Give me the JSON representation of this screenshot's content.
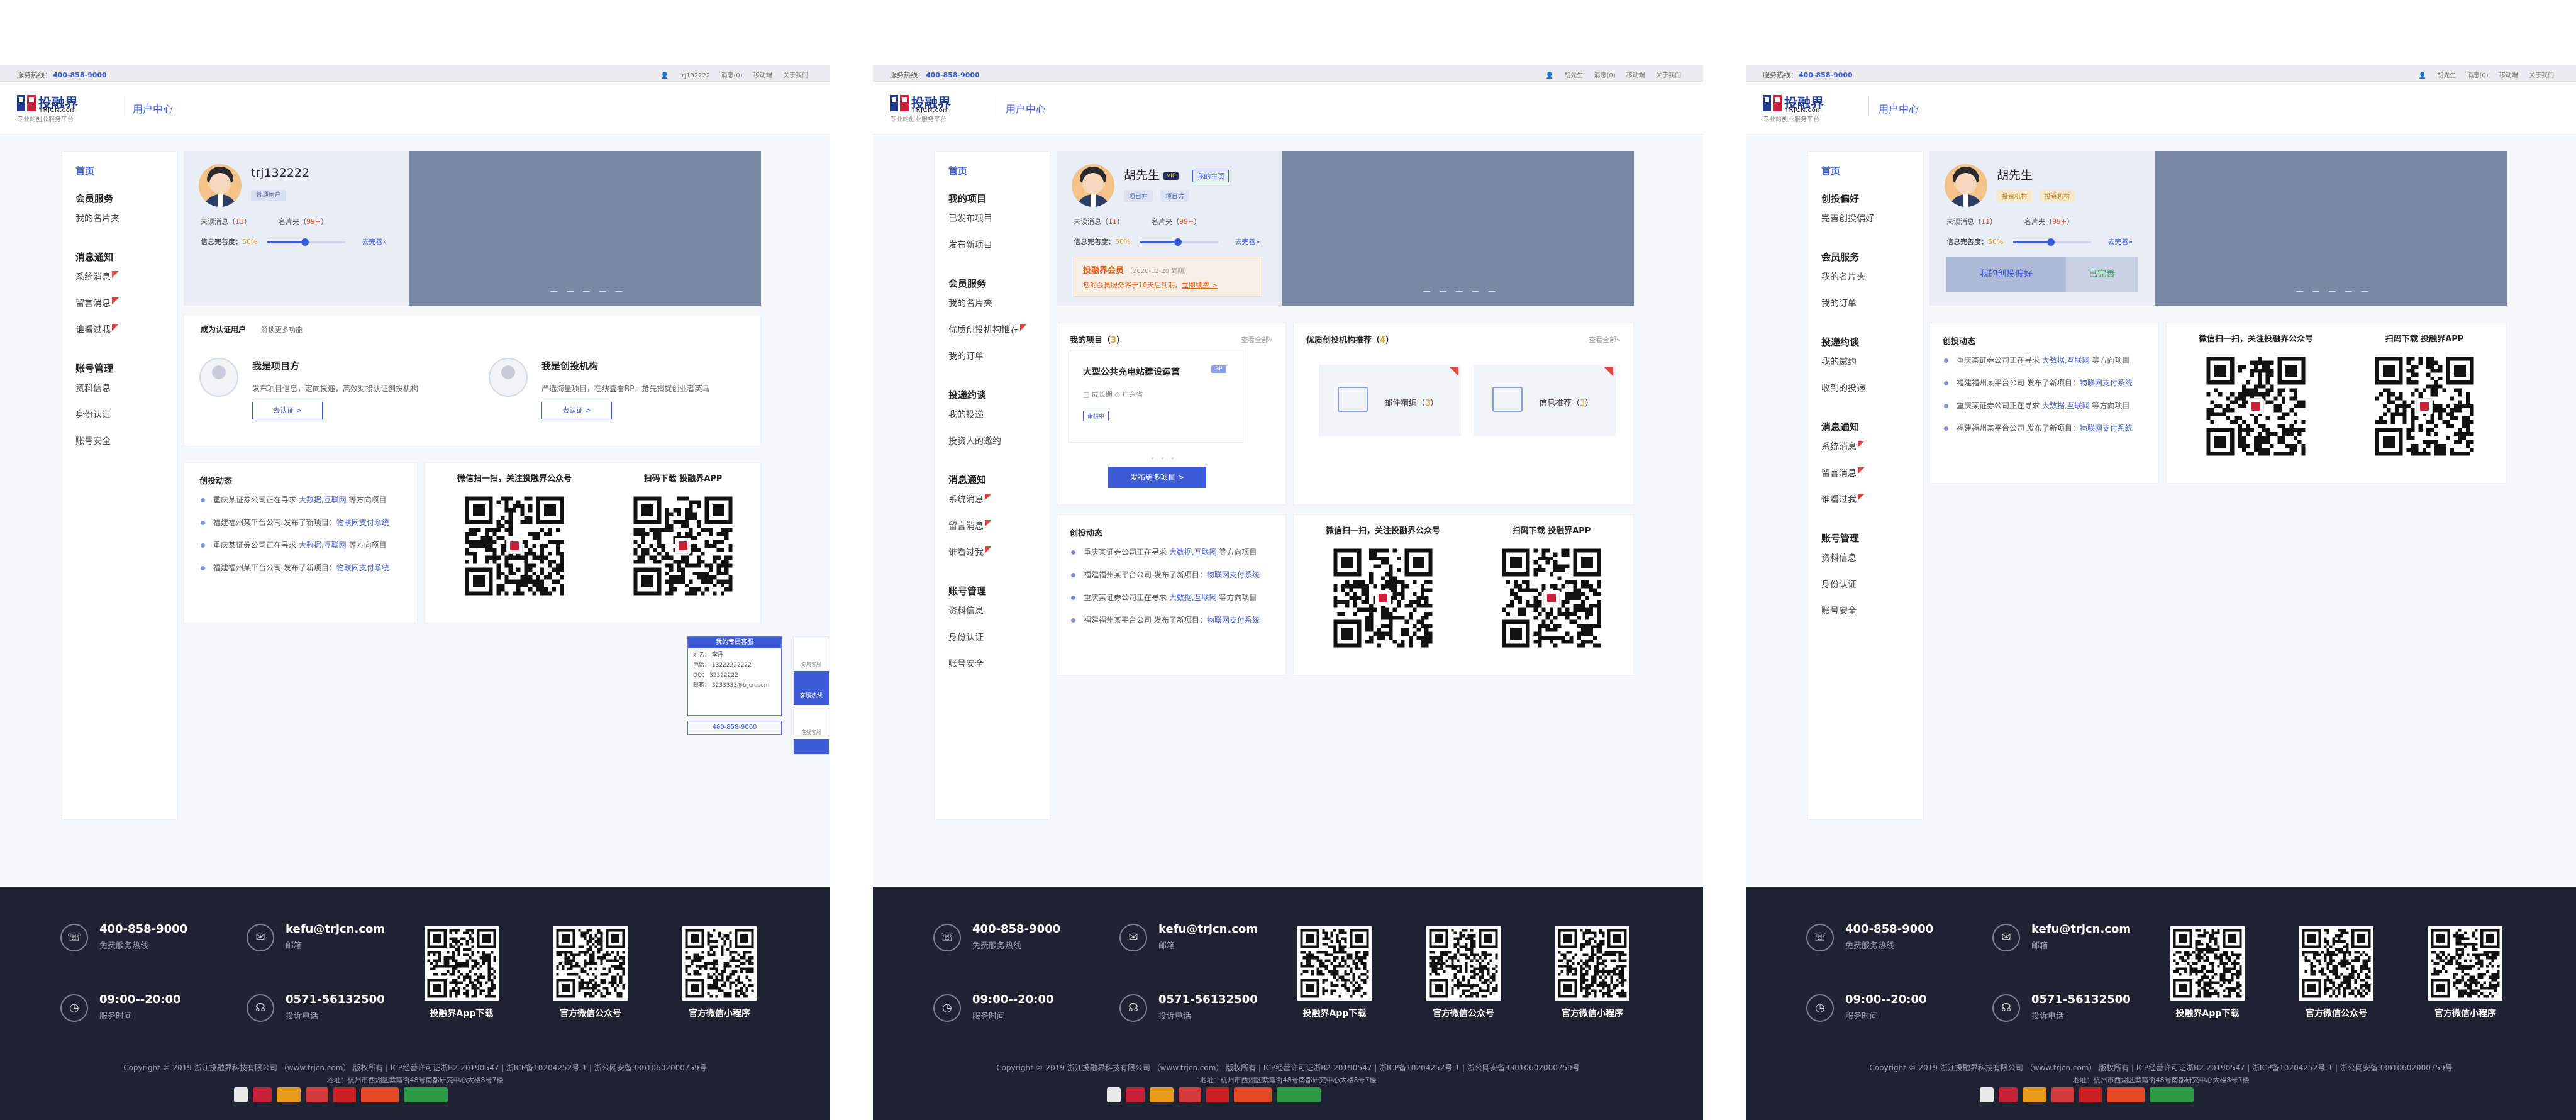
{
  "common": {
    "hotline_label": "服务热线：",
    "hotline": "400-858-9000",
    "top_links": [
      "消息(0)",
      "移动端",
      "关于我们"
    ],
    "logo_cn": "投融界",
    "logo_en": "TRJCN.com",
    "slogan": "专业的创业服务平台",
    "user_center": "用户中心",
    "feed_title": "创投动态",
    "feed": [
      {
        "text": "重庆某证券公司正在寻求 ",
        "hl": "大数据,互联网",
        "tail": " 等方向项目"
      },
      {
        "text": "福建福州某平台公司 发布了新项目：",
        "hl": "物联网支付系统",
        "tail": ""
      },
      {
        "text": "重庆某证券公司正在寻求 ",
        "hl": "大数据,互联网",
        "tail": " 等方向项目"
      },
      {
        "text": "福建福州某平台公司 发布了新项目：",
        "hl": "物联网支付系统",
        "tail": ""
      }
    ],
    "wechat_qr": "微信扫一扫，关注投融界公众号",
    "app_qr": "扫码下载 投融界APP",
    "profile_dots": "— — — — —",
    "stat_unread": "未读消息（",
    "stat_unread_n": "11",
    "stat_close": "）",
    "stat_card": "名片夹（",
    "stat_card_n": "99+",
    "comp_label": "信息完善度：",
    "comp_pct": "50%",
    "comp_more": "去完善»",
    "footer": {
      "phone": "400-858-9000",
      "phone_l": "免费服务热线",
      "email": "kefu@trjcn.com",
      "email_l": "邮箱",
      "hours": "09:00--20:00",
      "hours_l": "服务时间",
      "complaint": "0571-56132500",
      "complaint_l": "投诉电话",
      "qr1": "投融界App下载",
      "qr2": "官方微信公众号",
      "qr3": "官方微信小程序",
      "copyright": "Copyright © 2019 浙江投融界科技有限公司  （www.trjcn.com）  版权所有 | ICP经营许可证浙B2-20190547 | 浙ICP备10204252号-1 | 浙公网安备33010602000759号",
      "address": "地址：杭州市西湖区紫霞街48号南都研究中心大楼8号7楼"
    }
  },
  "page1": {
    "sidebar": {
      "home": "首页",
      "groups": [
        {
          "title": "会员服务",
          "items": [
            {
              "label": "我的名片夹",
              "flag": false
            }
          ]
        },
        {
          "title": "消息通知",
          "items": [
            {
              "label": "系统消息",
              "flag": true
            },
            {
              "label": "留言消息",
              "flag": true
            },
            {
              "label": "谁看过我",
              "flag": true
            }
          ]
        },
        {
          "title": "账号管理",
          "items": [
            {
              "label": "资料信息",
              "flag": false
            },
            {
              "label": "身份认证",
              "flag": false
            },
            {
              "label": "账号安全",
              "flag": false
            }
          ]
        }
      ]
    },
    "user": "trj132222",
    "user_badge": "普通用户",
    "auth_title": "成为认证用户",
    "auth_more": "解锁更多功能",
    "opt1_title": "我是项目方",
    "opt1_desc": "发布项目信息，定向投递，高效对接认证创投机构",
    "opt1_btn": "去认证 >",
    "opt2_title": "我是创投机构",
    "opt2_desc": "严选海量项目，在线查看BP，抢先捕捉创业者英马",
    "opt2_btn": "去认证 >",
    "cs_title": "我的专属客服",
    "cs_rows": [
      "姓名：  李丹",
      "电话：  13222222222",
      "QQ：   32322222",
      "邮箱：  3233333@trjcn.com"
    ],
    "cs_tel": "400-858-9000",
    "rail": [
      "专属客服",
      "客服热线",
      "在线客服"
    ]
  },
  "page2": {
    "sidebar": {
      "home": "首页",
      "groups": [
        {
          "title": "我的项目",
          "items": [
            {
              "label": "已发布项目",
              "flag": false
            },
            {
              "label": "发布新项目",
              "flag": false
            }
          ]
        },
        {
          "title": "会员服务",
          "items": [
            {
              "label": "我的名片夹",
              "flag": false
            },
            {
              "label": "优质创投机构推荐",
              "flag": true
            },
            {
              "label": "我的订单",
              "flag": false
            }
          ]
        },
        {
          "title": "投递约谈",
          "items": [
            {
              "label": "我的投递",
              "flag": false
            },
            {
              "label": "投资人的邀约",
              "flag": false
            }
          ]
        },
        {
          "title": "消息通知",
          "items": [
            {
              "label": "系统消息",
              "flag": true
            },
            {
              "label": "留言消息",
              "flag": true
            },
            {
              "label": "谁看过我",
              "flag": true
            }
          ]
        },
        {
          "title": "账号管理",
          "items": [
            {
              "label": "资料信息",
              "flag": false
            },
            {
              "label": "身份认证",
              "flag": false
            },
            {
              "label": "账号安全",
              "flag": false
            }
          ]
        }
      ]
    },
    "user": "胡先生",
    "vip": "VIP",
    "my_home": "我的主页",
    "tags": [
      "项目方",
      "项目方"
    ],
    "member_title": "投融界会员",
    "member_date": "（2020-12-20 到期）",
    "member_desc": "您的会员服务将于10天后到期，",
    "member_link": "立即续费 >",
    "proj_title": "我的项目",
    "proj_count": "3",
    "proj_more": "查看全部»",
    "proj_name": "大型公共充电站建设运营",
    "proj_tag": "BP",
    "proj_meta": "□ 成长期    ◇ 广东省",
    "proj_chip": "审核中",
    "proj_btn": "发布更多项目 >",
    "rec_title": "优质创投机构推荐",
    "rec_count": "4",
    "rec_more": "查看全部»",
    "rec1": "邮件精编",
    "rec1_n": "3",
    "rec2": "信息推荐",
    "rec2_n": "3"
  },
  "page3": {
    "sidebar": {
      "home": "首页",
      "groups": [
        {
          "title": "创投偏好",
          "items": [
            {
              "label": "完善创投偏好",
              "flag": false
            }
          ]
        },
        {
          "title": "会员服务",
          "items": [
            {
              "label": "我的名片夹",
              "flag": false
            },
            {
              "label": "我的订单",
              "flag": false
            }
          ]
        },
        {
          "title": "投递约谈",
          "items": [
            {
              "label": "我的邀约",
              "flag": false
            },
            {
              "label": "收到的投递",
              "flag": false
            }
          ]
        },
        {
          "title": "消息通知",
          "items": [
            {
              "label": "系统消息",
              "flag": true
            },
            {
              "label": "留言消息",
              "flag": true
            },
            {
              "label": "谁看过我",
              "flag": true
            }
          ]
        },
        {
          "title": "账号管理",
          "items": [
            {
              "label": "资料信息",
              "flag": false
            },
            {
              "label": "身份认证",
              "flag": false
            },
            {
              "label": "账号安全",
              "flag": false
            }
          ]
        }
      ]
    },
    "user": "胡先生",
    "tags": [
      "投资机构",
      "投资机构"
    ],
    "pref_btn": "我的创投偏好",
    "pref_done": "已完善"
  }
}
